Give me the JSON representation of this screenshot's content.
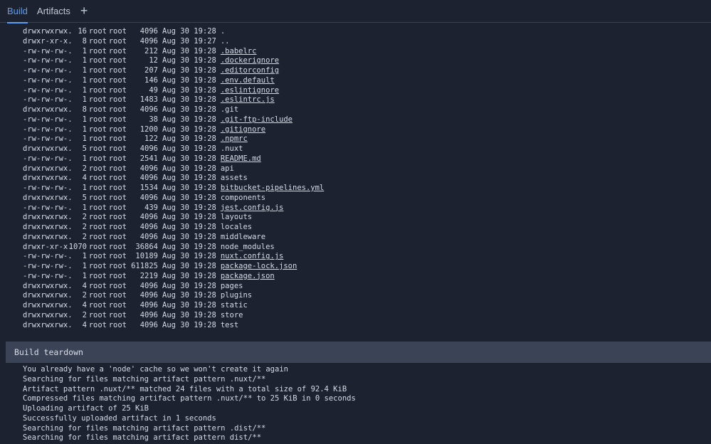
{
  "tabs": {
    "build": "Build",
    "artifacts": "Artifacts",
    "add": "+"
  },
  "listing": [
    {
      "perm": "drwxrwxrwx.",
      "links": "16",
      "owner": "root",
      "group": "root",
      "size": "4096",
      "date": "Aug 30 19:28",
      "name": ".",
      "link": false
    },
    {
      "perm": "drwxr-xr-x.",
      "links": "8",
      "owner": "root",
      "group": "root",
      "size": "4096",
      "date": "Aug 30 19:27",
      "name": "..",
      "link": false
    },
    {
      "perm": "-rw-rw-rw-.",
      "links": "1",
      "owner": "root",
      "group": "root",
      "size": "212",
      "date": "Aug 30 19:28",
      "name": ".babelrc",
      "link": true
    },
    {
      "perm": "-rw-rw-rw-.",
      "links": "1",
      "owner": "root",
      "group": "root",
      "size": "12",
      "date": "Aug 30 19:28",
      "name": ".dockerignore",
      "link": true
    },
    {
      "perm": "-rw-rw-rw-.",
      "links": "1",
      "owner": "root",
      "group": "root",
      "size": "207",
      "date": "Aug 30 19:28",
      "name": ".editorconfig",
      "link": true
    },
    {
      "perm": "-rw-rw-rw-.",
      "links": "1",
      "owner": "root",
      "group": "root",
      "size": "146",
      "date": "Aug 30 19:28",
      "name": ".env.default",
      "link": true
    },
    {
      "perm": "-rw-rw-rw-.",
      "links": "1",
      "owner": "root",
      "group": "root",
      "size": "49",
      "date": "Aug 30 19:28",
      "name": ".eslintignore",
      "link": true
    },
    {
      "perm": "-rw-rw-rw-.",
      "links": "1",
      "owner": "root",
      "group": "root",
      "size": "1483",
      "date": "Aug 30 19:28",
      "name": ".eslintrc.js",
      "link": true
    },
    {
      "perm": "drwxrwxrwx.",
      "links": "8",
      "owner": "root",
      "group": "root",
      "size": "4096",
      "date": "Aug 30 19:28",
      "name": ".git",
      "link": false
    },
    {
      "perm": "-rw-rw-rw-.",
      "links": "1",
      "owner": "root",
      "group": "root",
      "size": "38",
      "date": "Aug 30 19:28",
      "name": ".git-ftp-include",
      "link": true
    },
    {
      "perm": "-rw-rw-rw-.",
      "links": "1",
      "owner": "root",
      "group": "root",
      "size": "1200",
      "date": "Aug 30 19:28",
      "name": ".gitignore",
      "link": true
    },
    {
      "perm": "-rw-rw-rw-.",
      "links": "1",
      "owner": "root",
      "group": "root",
      "size": "122",
      "date": "Aug 30 19:28",
      "name": ".npmrc",
      "link": true
    },
    {
      "perm": "drwxrwxrwx.",
      "links": "5",
      "owner": "root",
      "group": "root",
      "size": "4096",
      "date": "Aug 30 19:28",
      "name": ".nuxt",
      "link": false
    },
    {
      "perm": "-rw-rw-rw-.",
      "links": "1",
      "owner": "root",
      "group": "root",
      "size": "2541",
      "date": "Aug 30 19:28",
      "name": "README.md",
      "link": true
    },
    {
      "perm": "drwxrwxrwx.",
      "links": "2",
      "owner": "root",
      "group": "root",
      "size": "4096",
      "date": "Aug 30 19:28",
      "name": "api",
      "link": false
    },
    {
      "perm": "drwxrwxrwx.",
      "links": "4",
      "owner": "root",
      "group": "root",
      "size": "4096",
      "date": "Aug 30 19:28",
      "name": "assets",
      "link": false
    },
    {
      "perm": "-rw-rw-rw-.",
      "links": "1",
      "owner": "root",
      "group": "root",
      "size": "1534",
      "date": "Aug 30 19:28",
      "name": "bitbucket-pipelines.yml",
      "link": true
    },
    {
      "perm": "drwxrwxrwx.",
      "links": "5",
      "owner": "root",
      "group": "root",
      "size": "4096",
      "date": "Aug 30 19:28",
      "name": "components",
      "link": false
    },
    {
      "perm": "-rw-rw-rw-.",
      "links": "1",
      "owner": "root",
      "group": "root",
      "size": "439",
      "date": "Aug 30 19:28",
      "name": "jest.config.js",
      "link": true
    },
    {
      "perm": "drwxrwxrwx.",
      "links": "2",
      "owner": "root",
      "group": "root",
      "size": "4096",
      "date": "Aug 30 19:28",
      "name": "layouts",
      "link": false
    },
    {
      "perm": "drwxrwxrwx.",
      "links": "2",
      "owner": "root",
      "group": "root",
      "size": "4096",
      "date": "Aug 30 19:28",
      "name": "locales",
      "link": false
    },
    {
      "perm": "drwxrwxrwx.",
      "links": "2",
      "owner": "root",
      "group": "root",
      "size": "4096",
      "date": "Aug 30 19:28",
      "name": "middleware",
      "link": false
    },
    {
      "perm": "drwxr-xr-x.",
      "links": "1070",
      "owner": "root",
      "group": "root",
      "size": "36864",
      "date": "Aug 30 19:28",
      "name": "node_modules",
      "link": false
    },
    {
      "perm": "-rw-rw-rw-.",
      "links": "1",
      "owner": "root",
      "group": "root",
      "size": "10189",
      "date": "Aug 30 19:28",
      "name": "nuxt.config.js",
      "link": true
    },
    {
      "perm": "-rw-rw-rw-.",
      "links": "1",
      "owner": "root",
      "group": "root",
      "size": "611825",
      "date": "Aug 30 19:28",
      "name": "package-lock.json",
      "link": true
    },
    {
      "perm": "-rw-rw-rw-.",
      "links": "1",
      "owner": "root",
      "group": "root",
      "size": "2219",
      "date": "Aug 30 19:28",
      "name": "package.json",
      "link": true
    },
    {
      "perm": "drwxrwxrwx.",
      "links": "4",
      "owner": "root",
      "group": "root",
      "size": "4096",
      "date": "Aug 30 19:28",
      "name": "pages",
      "link": false
    },
    {
      "perm": "drwxrwxrwx.",
      "links": "2",
      "owner": "root",
      "group": "root",
      "size": "4096",
      "date": "Aug 30 19:28",
      "name": "plugins",
      "link": false
    },
    {
      "perm": "drwxrwxrwx.",
      "links": "4",
      "owner": "root",
      "group": "root",
      "size": "4096",
      "date": "Aug 30 19:28",
      "name": "static",
      "link": false
    },
    {
      "perm": "drwxrwxrwx.",
      "links": "2",
      "owner": "root",
      "group": "root",
      "size": "4096",
      "date": "Aug 30 19:28",
      "name": "store",
      "link": false
    },
    {
      "perm": "drwxrwxrwx.",
      "links": "4",
      "owner": "root",
      "group": "root",
      "size": "4096",
      "date": "Aug 30 19:28",
      "name": "test",
      "link": false
    }
  ],
  "teardown": {
    "title": "Build teardown",
    "lines": [
      "You already have a 'node' cache so we won't create it again",
      "Searching for files matching artifact pattern .nuxt/**",
      "Artifact pattern .nuxt/** matched 24 files with a total size of 92.4 KiB",
      "Compressed files matching artifact pattern .nuxt/** to 25 KiB in 0 seconds",
      "Uploading artifact of 25 KiB",
      "Successfully uploaded artifact in 1 seconds",
      "Searching for files matching artifact pattern .dist/**",
      "Searching for files matching artifact pattern dist/**"
    ]
  }
}
